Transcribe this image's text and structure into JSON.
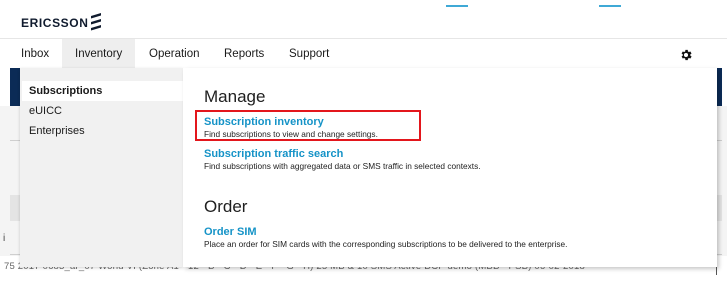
{
  "header": {
    "logo_text": "ERICSSON"
  },
  "nav": {
    "tabs": [
      {
        "label": "Inbox"
      },
      {
        "label": "Inventory"
      },
      {
        "label": "Operation"
      },
      {
        "label": "Reports"
      },
      {
        "label": "Support"
      }
    ],
    "active_tab": "Inventory"
  },
  "dropdown": {
    "sidebar": [
      {
        "label": "Subscriptions"
      },
      {
        "label": "eUICC"
      },
      {
        "label": "Enterprises"
      }
    ],
    "sections": [
      {
        "title": "Manage",
        "items": [
          {
            "label": "Subscription inventory",
            "description": "Find subscriptions to view and change settings."
          },
          {
            "label": "Subscription traffic search",
            "description": "Find subscriptions with aggregated data or SMS traffic in selected contexts."
          }
        ]
      },
      {
        "title": "Order",
        "items": [
          {
            "label": "Order SIM",
            "description": "Place an order for SIM cards with the corresponding subscriptions to be delivered to the enterprise."
          }
        ]
      }
    ]
  },
  "background": {
    "left_char": "i",
    "right_char": "t",
    "row_text": "75 2017 0683_ar_07     World VI (Zone A1 - 12 - B - C - D - E - F - G - H) 25 MB & 10 SMS        Active        DCP demo (MBB - PSB)       06-02-2018"
  },
  "colors": {
    "brand_navy": "#0b2b56",
    "link_blue": "#1593c7",
    "highlight_red": "#e3161c"
  },
  "icons": {
    "settings": "gear-icon",
    "logo": "ericsson-logo-mark"
  }
}
